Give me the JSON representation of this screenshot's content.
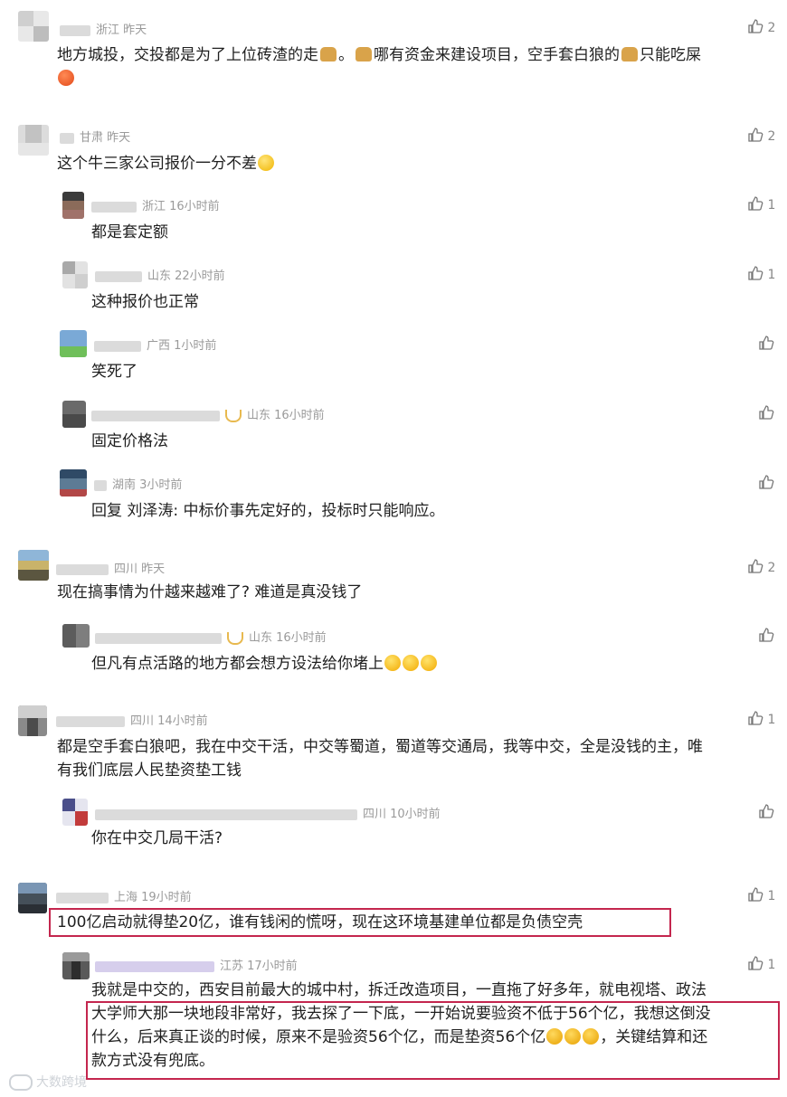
{
  "comments": [
    {
      "meta": "浙江  昨天",
      "likes": "2",
      "text_before": "地方城投，交投都是为了上位砖渣的走",
      "text_mid1": "。",
      "text_mid2": "哪有资金来建设项目，空手套白狼的",
      "text_after": "只能吃屎"
    },
    {
      "meta": "甘肃  昨天",
      "likes": "2",
      "text": "这个牛三家公司报价一分不差"
    },
    {
      "meta": "浙江  16小时前",
      "likes": "1",
      "text": "都是套定额"
    },
    {
      "meta": "山东  22小时前",
      "likes": "1",
      "text": "这种报价也正常"
    },
    {
      "meta": "广西  1小时前",
      "likes": "",
      "text": "笑死了"
    },
    {
      "meta": "山东  16小时前",
      "likes": "",
      "text": "固定价格法"
    },
    {
      "meta": "湖南  3小时前",
      "likes": "",
      "text": "回复 刘泽涛: 中标价事先定好的，投标时只能响应。"
    },
    {
      "meta": "四川  昨天",
      "likes": "2",
      "text": "现在搞事情为什越来越难了? 难道是真没钱了"
    },
    {
      "meta": "山东  16小时前",
      "likes": "",
      "text": "但凡有点活路的地方都会想方设法给你堵上"
    },
    {
      "meta": "四川  14小时前",
      "likes": "1",
      "text_line1": "都是空手套白狼吧，我在中交干活，中交等蜀道，蜀道等交通局，我等中交，全是没钱的主，唯",
      "text_line2": "有我们底层人民垫资垫工钱"
    },
    {
      "meta": "四川  10小时前",
      "likes": "",
      "text": "你在中交几局干活?"
    },
    {
      "meta": "上海  19小时前",
      "likes": "1",
      "text": "100亿启动就得垫20亿，谁有钱闲的慌呀，现在这环境基建单位都是负债空壳"
    },
    {
      "meta": "江苏  17小时前",
      "likes": "1",
      "text_line1": "我就是中交的，西安目前最大的城中村，拆迁改造项目，一直拖了好多年，就电视塔、政法",
      "text_line2": "大学师大那一块地段非常好，我去探了一下底，一开始说要验资不低于56个亿，我想这倒没",
      "text_line3": "什么，后来真正谈的时候，原来不是验资56个亿，而是垫资56个亿",
      "text_line3b": "，关键结算和还",
      "text_line4": "款方式没有兜底。"
    }
  ],
  "watermark": "大数跨境",
  "colors": {
    "highlight": "#c4264e",
    "meta": "#9a9a9a",
    "like": "#888888"
  }
}
